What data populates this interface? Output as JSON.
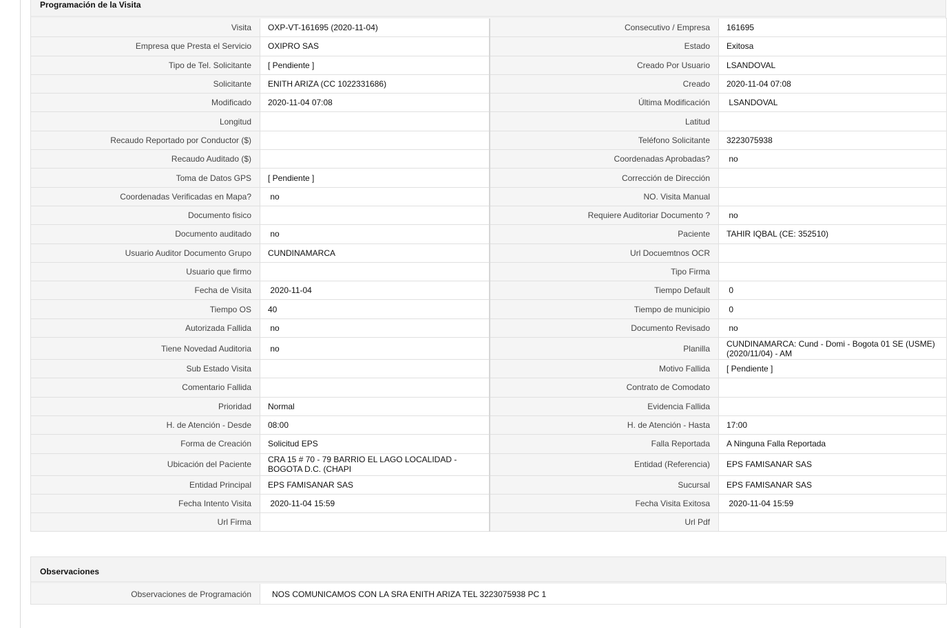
{
  "schedule": {
    "title": "Programación de la Visita",
    "rows": [
      [
        "Visita",
        "OXP-VT-161695 (2020-11-04)",
        "Consecutivo / Empresa",
        "161695"
      ],
      [
        "Empresa que Presta el Servicio",
        "OXIPRO SAS",
        "Estado",
        "Exitosa"
      ],
      [
        "Tipo de Tel. Solicitante",
        "[ Pendiente ]",
        "Creado Por Usuario",
        "LSANDOVAL"
      ],
      [
        "Solicitante",
        "ENITH ARIZA (CC 1022331686)",
        "Creado",
        "2020-11-04 07:08"
      ],
      [
        "Modificado",
        "2020-11-04 07:08",
        "Última Modificación",
        " LSANDOVAL"
      ],
      [
        "Longitud",
        "",
        "Latitud",
        ""
      ],
      [
        "Recaudo Reportado por Conductor ($)",
        "",
        "Teléfono Solicitante",
        "3223075938"
      ],
      [
        "Recaudo Auditado ($)",
        "",
        "Coordenadas Aprobadas?",
        " no"
      ],
      [
        "Toma de Datos GPS",
        "[ Pendiente ]",
        "Corrección de Dirección",
        ""
      ],
      [
        "Coordenadas Verificadas en Mapa?",
        " no",
        "NO. Visita Manual",
        ""
      ],
      [
        "Documento fisico",
        "",
        "Requiere Auditoriar Documento ?",
        " no"
      ],
      [
        "Documento auditado",
        " no",
        "Paciente",
        "TAHIR IQBAL (CE: 352510)"
      ],
      [
        "Usuario Auditor Documento Grupo",
        "CUNDINAMARCA",
        "Url Docuemtnos OCR",
        ""
      ],
      [
        "Usuario que firmo",
        "",
        "Tipo Firma",
        ""
      ],
      [
        "Fecha de Visita",
        " 2020-11-04",
        "Tiempo Default",
        " 0"
      ],
      [
        "Tiempo OS",
        "40",
        "Tiempo de municipio",
        " 0"
      ],
      [
        "Autorizada Fallida",
        " no",
        "Documento Revisado",
        " no"
      ],
      [
        "Tiene Novedad Auditoria",
        " no",
        "Planilla",
        "CUNDINAMARCA: Cund - Domi - Bogota 01 SE (USME) (2020/11/04) - AM"
      ],
      [
        "Sub Estado Visita",
        "",
        "Motivo Fallida",
        "[ Pendiente ]"
      ],
      [
        "Comentario Fallida",
        "",
        "Contrato de Comodato",
        ""
      ],
      [
        "Prioridad",
        "Normal",
        "Evidencia Fallida",
        ""
      ],
      [
        "H. de Atención - Desde",
        "08:00",
        "H. de Atención - Hasta",
        "17:00"
      ],
      [
        "Forma de Creación",
        "Solicitud EPS",
        "Falla Reportada",
        "A Ninguna Falla Reportada"
      ],
      [
        "Ubicación del Paciente",
        "CRA 15 # 70 - 79 BARRIO EL LAGO LOCALIDAD - BOGOTA D.C. (CHAPI",
        "Entidad (Referencia)",
        "EPS FAMISANAR SAS"
      ],
      [
        "Entidad Principal",
        "EPS FAMISANAR SAS",
        "Sucursal",
        "EPS FAMISANAR SAS"
      ],
      [
        "Fecha Intento Visita",
        " 2020-11-04 15:59",
        "Fecha Visita Exitosa",
        " 2020-11-04 15:59"
      ],
      [
        "Url Firma",
        "",
        "Url Pdf",
        ""
      ]
    ]
  },
  "observations": {
    "title": "Observaciones",
    "label": "Observaciones de Programación",
    "value": "NOS COMUNICAMOS CON LA SRA ENITH ARIZA TEL 3223075938 PC 1"
  }
}
